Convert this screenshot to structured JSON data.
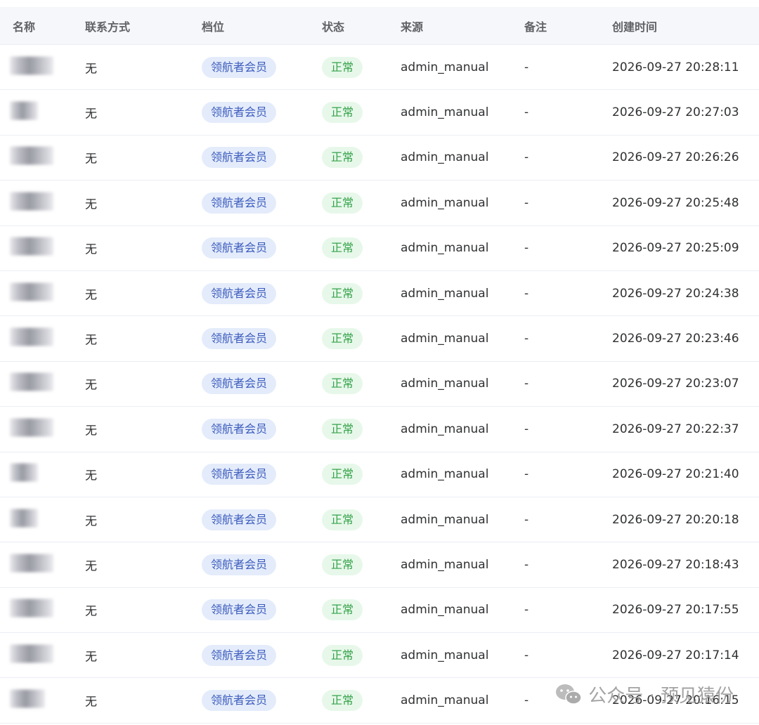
{
  "table": {
    "headers": {
      "name": "名称",
      "contact": "联系方式",
      "tier": "档位",
      "status": "状态",
      "source": "来源",
      "note": "备注",
      "created": "创建时间"
    },
    "rows": [
      {
        "contact": "无",
        "tier": "领航者会员",
        "status": "正常",
        "source": "admin_manual",
        "note": "-",
        "created": "2026-09-27 20:28:11"
      },
      {
        "contact": "无",
        "tier": "领航者会员",
        "status": "正常",
        "source": "admin_manual",
        "note": "-",
        "created": "2026-09-27 20:27:03"
      },
      {
        "contact": "无",
        "tier": "领航者会员",
        "status": "正常",
        "source": "admin_manual",
        "note": "-",
        "created": "2026-09-27 20:26:26"
      },
      {
        "contact": "无",
        "tier": "领航者会员",
        "status": "正常",
        "source": "admin_manual",
        "note": "-",
        "created": "2026-09-27 20:25:48"
      },
      {
        "contact": "无",
        "tier": "领航者会员",
        "status": "正常",
        "source": "admin_manual",
        "note": "-",
        "created": "2026-09-27 20:25:09"
      },
      {
        "contact": "无",
        "tier": "领航者会员",
        "status": "正常",
        "source": "admin_manual",
        "note": "-",
        "created": "2026-09-27 20:24:38"
      },
      {
        "contact": "无",
        "tier": "领航者会员",
        "status": "正常",
        "source": "admin_manual",
        "note": "-",
        "created": "2026-09-27 20:23:46"
      },
      {
        "contact": "无",
        "tier": "领航者会员",
        "status": "正常",
        "source": "admin_manual",
        "note": "-",
        "created": "2026-09-27 20:23:07"
      },
      {
        "contact": "无",
        "tier": "领航者会员",
        "status": "正常",
        "source": "admin_manual",
        "note": "-",
        "created": "2026-09-27 20:22:37"
      },
      {
        "contact": "无",
        "tier": "领航者会员",
        "status": "正常",
        "source": "admin_manual",
        "note": "-",
        "created": "2026-09-27 20:21:40"
      },
      {
        "contact": "无",
        "tier": "领航者会员",
        "status": "正常",
        "source": "admin_manual",
        "note": "-",
        "created": "2026-09-27 20:20:18"
      },
      {
        "contact": "无",
        "tier": "领航者会员",
        "status": "正常",
        "source": "admin_manual",
        "note": "-",
        "created": "2026-09-27 20:18:43"
      },
      {
        "contact": "无",
        "tier": "领航者会员",
        "status": "正常",
        "source": "admin_manual",
        "note": "-",
        "created": "2026-09-27 20:17:55"
      },
      {
        "contact": "无",
        "tier": "领航者会员",
        "status": "正常",
        "source": "admin_manual",
        "note": "-",
        "created": "2026-09-27 20:17:14"
      },
      {
        "contact": "无",
        "tier": "领航者会员",
        "status": "正常",
        "source": "admin_manual",
        "note": "-",
        "created": "2026-09-27 20:16:15"
      }
    ]
  },
  "watermark": {
    "text": "公众号 · 预见猿份",
    "icon": "wechat-icon"
  },
  "colors": {
    "header_bg": "#f5f7fa",
    "tier_tag_bg": "#e4ecfb",
    "tier_tag_text": "#3b5bbd",
    "status_tag_bg": "#e7f8ea",
    "status_tag_text": "#35a24a",
    "row_divider": "#ebeef5"
  }
}
